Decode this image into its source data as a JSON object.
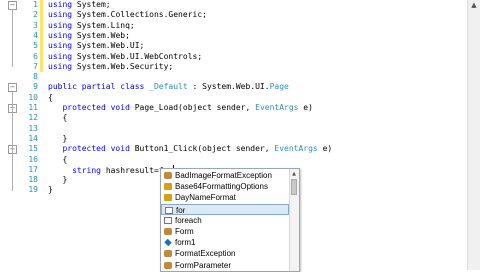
{
  "editor": {
    "line_numbers": [
      "1",
      "2",
      "3",
      "4",
      "5",
      "6",
      "7",
      "8",
      "9",
      "10",
      "11",
      "12",
      "13",
      "14",
      "15",
      "16",
      "17",
      "18",
      "19"
    ],
    "lines": [
      {
        "kw": "using",
        "rest": " System;"
      },
      {
        "kw": "using",
        "rest": " System.Collections.Generic;"
      },
      {
        "kw": "using",
        "rest": " System.Linq;"
      },
      {
        "kw": "using",
        "rest": " System.Web;"
      },
      {
        "kw": "using",
        "rest": " System.Web.UI;"
      },
      {
        "kw": "using",
        "rest": " System.Web.UI.WebControls;"
      },
      {
        "kw": "using",
        "rest": " System.Web.Security;"
      },
      {
        "kw": "",
        "rest": ""
      },
      {
        "kw": "public partial class",
        "rest": " "
      },
      {
        "kw": "",
        "rest": "{"
      },
      {
        "kw": "protected void",
        "rest": " Page_Load(object sender, "
      },
      {
        "kw": "",
        "rest": "{"
      },
      {
        "kw": "",
        "rest": ""
      },
      {
        "kw": "",
        "rest": "}"
      },
      {
        "kw": "protected void",
        "rest": " Button1_Click(object sender, "
      },
      {
        "kw": "",
        "rest": "{"
      },
      {
        "kw": "string",
        "rest": " hashresult=for"
      },
      {
        "kw": "",
        "rest": "}"
      },
      {
        "kw": "",
        "rest": "}"
      }
    ],
    "class_name": "_Default",
    "class_base": " : System.Web.UI.",
    "class_page": "Page",
    "eventargs": "EventArgs",
    "event_suffix": " e)"
  },
  "autocomplete": {
    "items": [
      {
        "label": "BadImageFormatException",
        "icon": "class-icon",
        "color": "#c08a3a"
      },
      {
        "label": "Base64FormattingOptions",
        "icon": "enum-icon",
        "color": "#d4a017"
      },
      {
        "label": "DayNameFormat",
        "icon": "enum-icon",
        "color": "#d4a017"
      },
      {
        "label": "for",
        "icon": "snippet-icon",
        "color": "#777777"
      },
      {
        "label": "foreach",
        "icon": "snippet-icon",
        "color": "#777777"
      },
      {
        "label": "Form",
        "icon": "class-icon",
        "color": "#c08a3a"
      },
      {
        "label": "form1",
        "icon": "field-icon",
        "color": "#1f6fb5"
      },
      {
        "label": "FormatException",
        "icon": "class-icon",
        "color": "#c08a3a"
      },
      {
        "label": "FormParameter",
        "icon": "class-icon",
        "color": "#c08a3a"
      }
    ],
    "selected_index": 3
  },
  "colors": {
    "keyword": "#0000ff",
    "type": "#2b91af",
    "line_number": "#2b91af"
  }
}
